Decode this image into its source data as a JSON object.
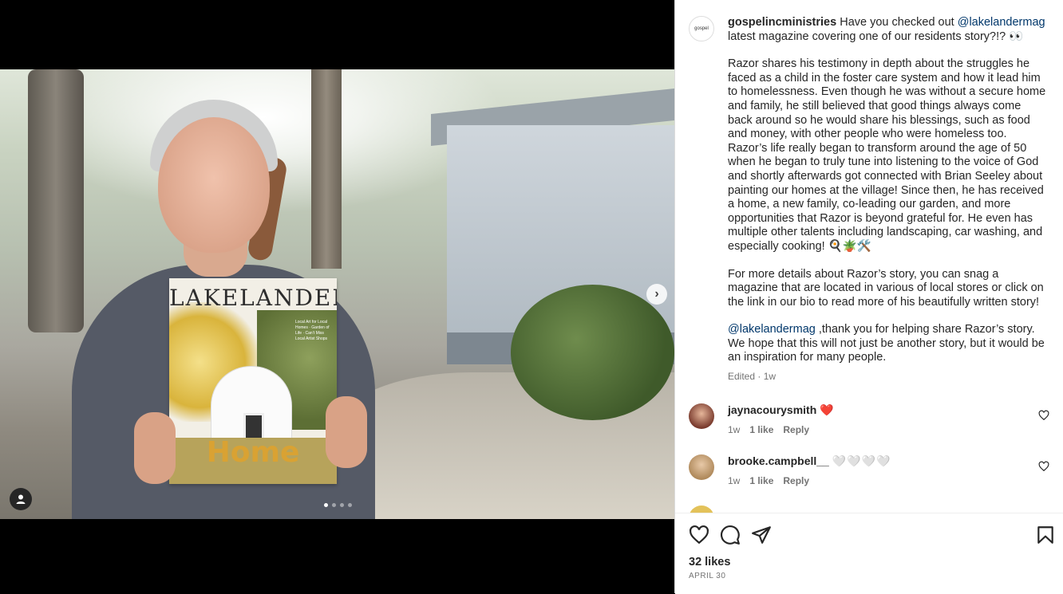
{
  "post": {
    "username": "gospelincministries",
    "caption_intro": "Have you checked out",
    "mention": "@lakelandermag",
    "caption_intro_rest": "latest magazine covering one of our residents story?!? 👀",
    "paragraph_1": "Razor shares his testimony in depth about the struggles he faced as a child in the foster care system and how it lead him to homelessness. Even though he was without a secure home and family, he still believed that good things always come back around so he would share his blessings, such as food and money, with other people who were homeless too. Razor’s life really began to transform around the age of 50 when he began to truly tune into listening to the voice of God and shortly afterwards got connected with Brian Seeley about painting our homes at the village! Since then, he has received a home, a new family, co-leading our garden, and more opportunities that Razor is beyond grateful for. He even has multiple other talents including landscaping, car washing, and especially cooking! 🍳🪴🛠️",
    "paragraph_2": "For more details about Razor’s story, you can snag a magazine that are located in various of local stores or click on the link in our bio to read more of his beautifully written story!",
    "paragraph_3_mention": "@lakelandermag",
    "paragraph_3": " ,thank you for helping share Razor’s story. We hope that this will not just be another story, but it would be an inspiration for many people.",
    "edited_label": "Edited · 1w",
    "avatar_text": "gospel"
  },
  "media": {
    "magazine_title": "LAKELANDER",
    "magazine_cover_word": "Home",
    "magazine_blurb": "Local Art for Local Homes · Garden of Life · Can’t Miss Local Artist Shops",
    "carousel_count": 4,
    "carousel_active": 1
  },
  "comments": [
    {
      "username": "jaynacourysmith",
      "text": "❤️",
      "time": "1w",
      "likes": "1 like",
      "reply": "Reply",
      "avatar_color": "#7a3b2e"
    },
    {
      "username": "brooke.campbell__",
      "text": "🤍🤍🤍🤍",
      "time": "1w",
      "likes": "1 like",
      "reply": "Reply",
      "avatar_color": "#b08a5c"
    }
  ],
  "footer": {
    "likes": "32 likes",
    "date": "APRIL 30"
  },
  "icons": [
    "heart-icon",
    "comment-icon",
    "share-icon",
    "bookmark-icon",
    "next-arrow-icon",
    "user-tag-icon"
  ]
}
